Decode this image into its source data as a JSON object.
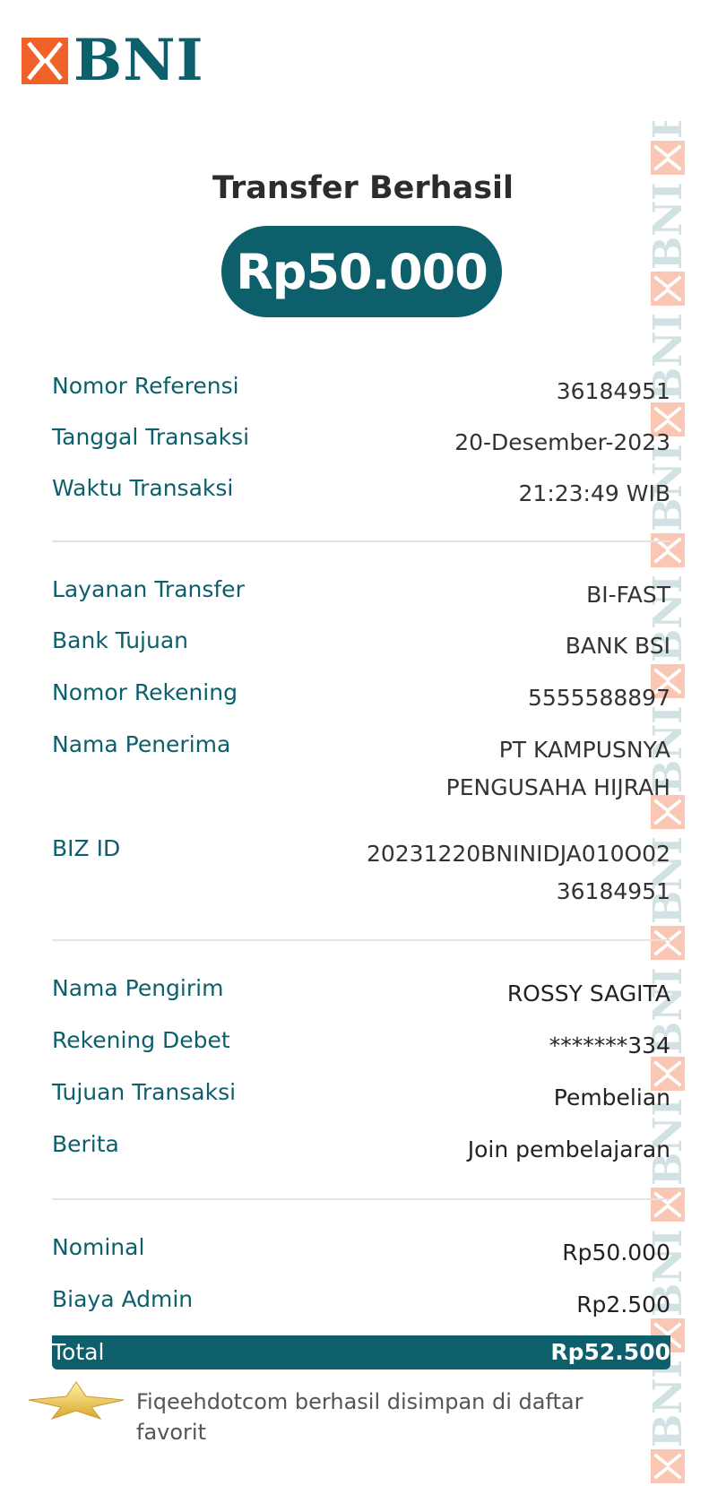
{
  "brand": {
    "name": "BNI",
    "primary_color": "#0c5f6b",
    "accent_color": "#f0622a"
  },
  "receipt": {
    "title": "Transfer Berhasil",
    "amount": "Rp50.000",
    "reference": {
      "label": "Nomor Referensi",
      "value": "36184951"
    },
    "date": {
      "label": "Tanggal Transaksi",
      "value": "20-Desember-2023"
    },
    "time": {
      "label": "Waktu Transaksi",
      "value": "21:23:49 WIB"
    },
    "service": {
      "label": "Layanan Transfer",
      "value": "BI-FAST"
    },
    "bank": {
      "label": "Bank Tujuan",
      "value": "BANK BSI"
    },
    "account_number": {
      "label": "Nomor Rekening",
      "value": "5555588897"
    },
    "recipient": {
      "label": "Nama Penerima",
      "value_line1": "PT KAMPUSNYA",
      "value_line2": "PENGUSAHA HIJRAH"
    },
    "biz_id": {
      "label": "BIZ ID",
      "value_line1": "20231220BNINIDJA010O02",
      "value_line2": "36184951"
    },
    "sender": {
      "label": "Nama Pengirim",
      "value": "ROSSY SAGITA"
    },
    "debit_account": {
      "label": "Rekening Debet",
      "value": "*******334"
    },
    "purpose": {
      "label": "Tujuan Transaksi",
      "value": "Pembelian"
    },
    "message": {
      "label": "Berita",
      "value": "Join pembelajaran"
    },
    "nominal": {
      "label": "Nominal",
      "value": "Rp50.000"
    },
    "admin_fee": {
      "label": "Biaya Admin",
      "value": "Rp2.500"
    },
    "total": {
      "label": "Total",
      "value": "Rp52.500"
    }
  },
  "favorite": {
    "icon": "star-icon",
    "note": "Fiqeehdotcom berhasil disimpan di daftar favorit"
  },
  "watermark": {
    "text": "BNI",
    "icon": "bni-logo-mark"
  }
}
